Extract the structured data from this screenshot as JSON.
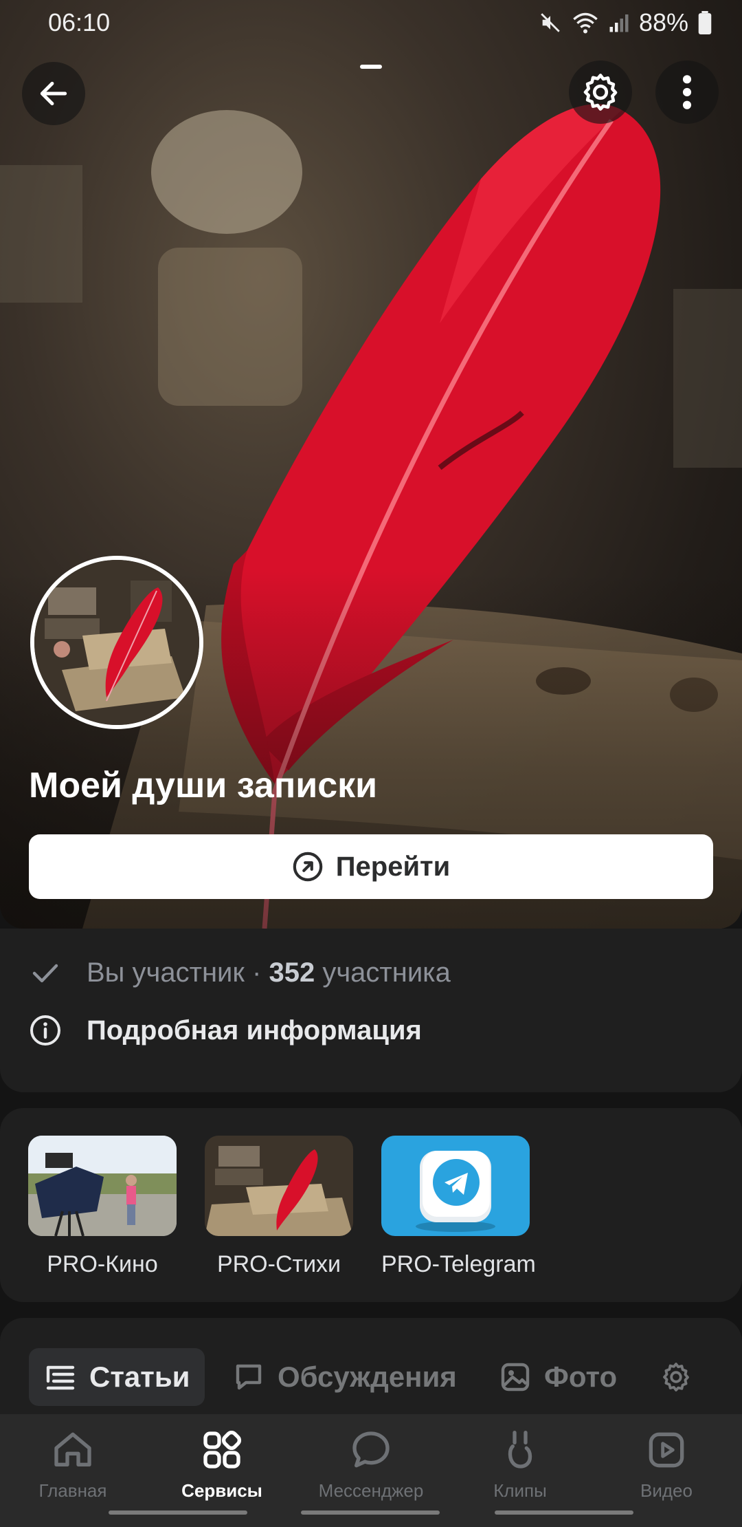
{
  "status_bar": {
    "time": "06:10",
    "battery": "88%"
  },
  "header": {
    "back_icon": "arrow-left-icon",
    "settings_icon": "gear-icon",
    "more_icon": "more-vertical-icon"
  },
  "group": {
    "title": "Моей души записки",
    "go_button": "Перейти"
  },
  "info": {
    "member_status": "Вы участник",
    "separator": "·",
    "member_count": "352",
    "member_word": "участника",
    "details": "Подробная информация"
  },
  "links": [
    {
      "label": "PRO-Кино"
    },
    {
      "label": "PRO-Стихи"
    },
    {
      "label": "PRO-Telegram"
    }
  ],
  "tabs": [
    {
      "label": "Статьи",
      "icon": "articles-icon",
      "active": true
    },
    {
      "label": "Обсуждения",
      "icon": "discussion-icon"
    },
    {
      "label": "Фото",
      "icon": "photo-icon"
    }
  ],
  "bottom_nav": [
    {
      "label": "Главная",
      "icon": "home-icon"
    },
    {
      "label": "Сервисы",
      "icon": "services-icon",
      "active": true
    },
    {
      "label": "Мессенджер",
      "icon": "messenger-icon"
    },
    {
      "label": "Клипы",
      "icon": "clips-icon"
    },
    {
      "label": "Видео",
      "icon": "video-icon"
    }
  ],
  "colors": {
    "background": "#141414",
    "card": "#1f1f1f",
    "feather": "#d8102a",
    "telegram": "#2aa3df"
  }
}
